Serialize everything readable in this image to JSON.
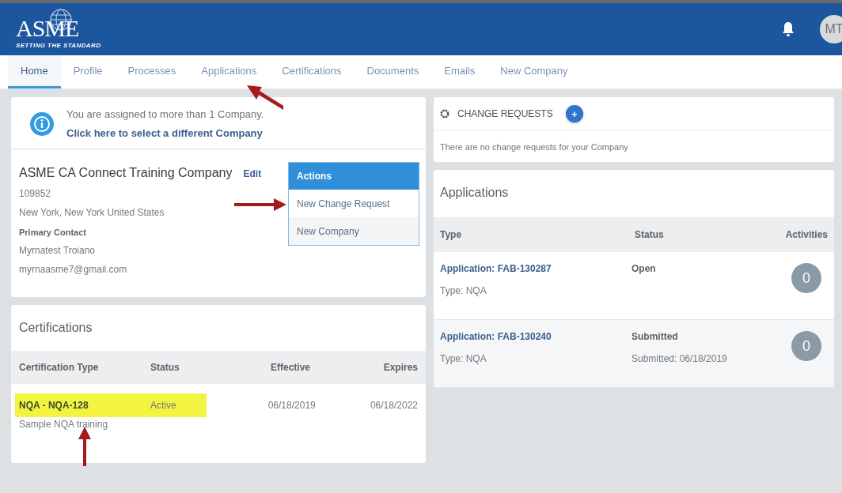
{
  "header": {
    "logo": {
      "name": "ASME",
      "tagline": "SETTING THE STANDARD"
    },
    "avatar": "MT"
  },
  "tabs": [
    {
      "label": "Home",
      "selected": true
    },
    {
      "label": "Profile",
      "selected": false
    },
    {
      "label": "Processes",
      "selected": false
    },
    {
      "label": "Applications",
      "selected": false
    },
    {
      "label": "Certifications",
      "selected": false
    },
    {
      "label": "Documents",
      "selected": false
    },
    {
      "label": "Emails",
      "selected": false
    },
    {
      "label": "New Company",
      "selected": false
    }
  ],
  "notice": {
    "text": "You are assigned to more than 1 Company.",
    "link": "Click here to select a different Company"
  },
  "company": {
    "name": "ASME CA Connect Training Company",
    "edit": "Edit",
    "id": "109852",
    "address": "New York, New York United States",
    "contact_label": "Primary Contact",
    "contact_name": "Myrnatest Troiano",
    "contact_email": "myrnaasme7@gmail.com"
  },
  "actions_menu": {
    "title": "Actions",
    "items": [
      "New Change Request",
      "New Company"
    ]
  },
  "certifications": {
    "title": "Certifications",
    "columns": [
      "Certification Type",
      "Status",
      "Effective",
      "Expires"
    ],
    "rows": [
      {
        "type": "NQA - NQA-128",
        "subtitle": "Sample NQA training",
        "status": "Active",
        "effective": "06/18/2019",
        "expires": "06/18/2022",
        "highlighted": true
      }
    ]
  },
  "change_requests": {
    "title": "CHANGE REQUESTS",
    "add": "+",
    "empty_text": "There are no change requests for your Company"
  },
  "applications": {
    "title": "Applications",
    "columns": [
      "Type",
      "Status",
      "Activities"
    ],
    "rows": [
      {
        "link": "Application: FAB-130287",
        "type": "Type: NQA",
        "status": "Open",
        "activities": "0"
      },
      {
        "link": "Application: FAB-130240",
        "type": "Type: NQA",
        "status": "Submitted",
        "status_detail": "Submitted: 06/18/2019",
        "activities": "0"
      }
    ]
  }
}
